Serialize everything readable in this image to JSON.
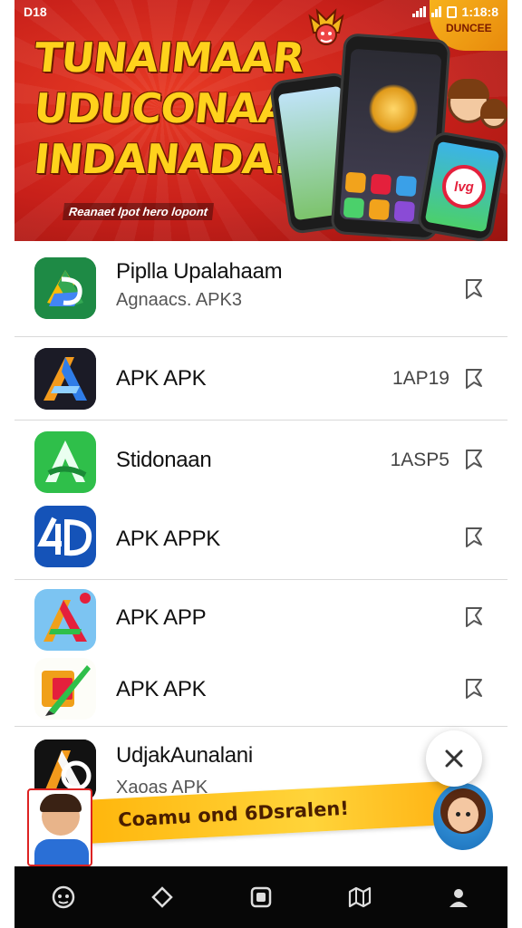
{
  "status_bar": {
    "left_text": "D18",
    "time": "1:18:8"
  },
  "banner": {
    "title_lines": [
      "TUNAIMAAR",
      "UDUCONAA",
      "INDANADA!"
    ],
    "subtitle": "Reanaet lpot hero lopont",
    "corner_badge_text": "DUNCEE",
    "phone_badge_text": "lvg",
    "colors": {
      "background": "#c8201a",
      "title": "#ffd21c"
    }
  },
  "apps": [
    {
      "name": "Piplla Upalahaam",
      "subtitle": "Agnaacs. APK3",
      "meta": "",
      "icon": "google-drive-style-icon"
    },
    {
      "name": "APK APK",
      "subtitle": "",
      "meta": "1AP19",
      "icon": "blue-orange-a-icon"
    },
    {
      "name": "Stidonaan",
      "subtitle": "",
      "meta": "1ASP5",
      "icon": "green-a-icon"
    },
    {
      "name": "APK APPK",
      "subtitle": "",
      "meta": "",
      "icon": "blue-4d-icon"
    },
    {
      "name": "APK APP",
      "subtitle": "",
      "meta": "",
      "icon": "colorful-a-icon"
    },
    {
      "name": "APK APK",
      "subtitle": "",
      "meta": "",
      "icon": "pen-edit-icon"
    },
    {
      "name": "UdjakAunalani",
      "subtitle": "Xaoas APK",
      "meta": "",
      "icon": "black-a-icon"
    }
  ],
  "promo": {
    "text": "Coamu ond 6Dsralen!"
  },
  "nav": [
    "assistant-icon",
    "back-icon",
    "home-icon",
    "map-icon",
    "profile-icon"
  ]
}
